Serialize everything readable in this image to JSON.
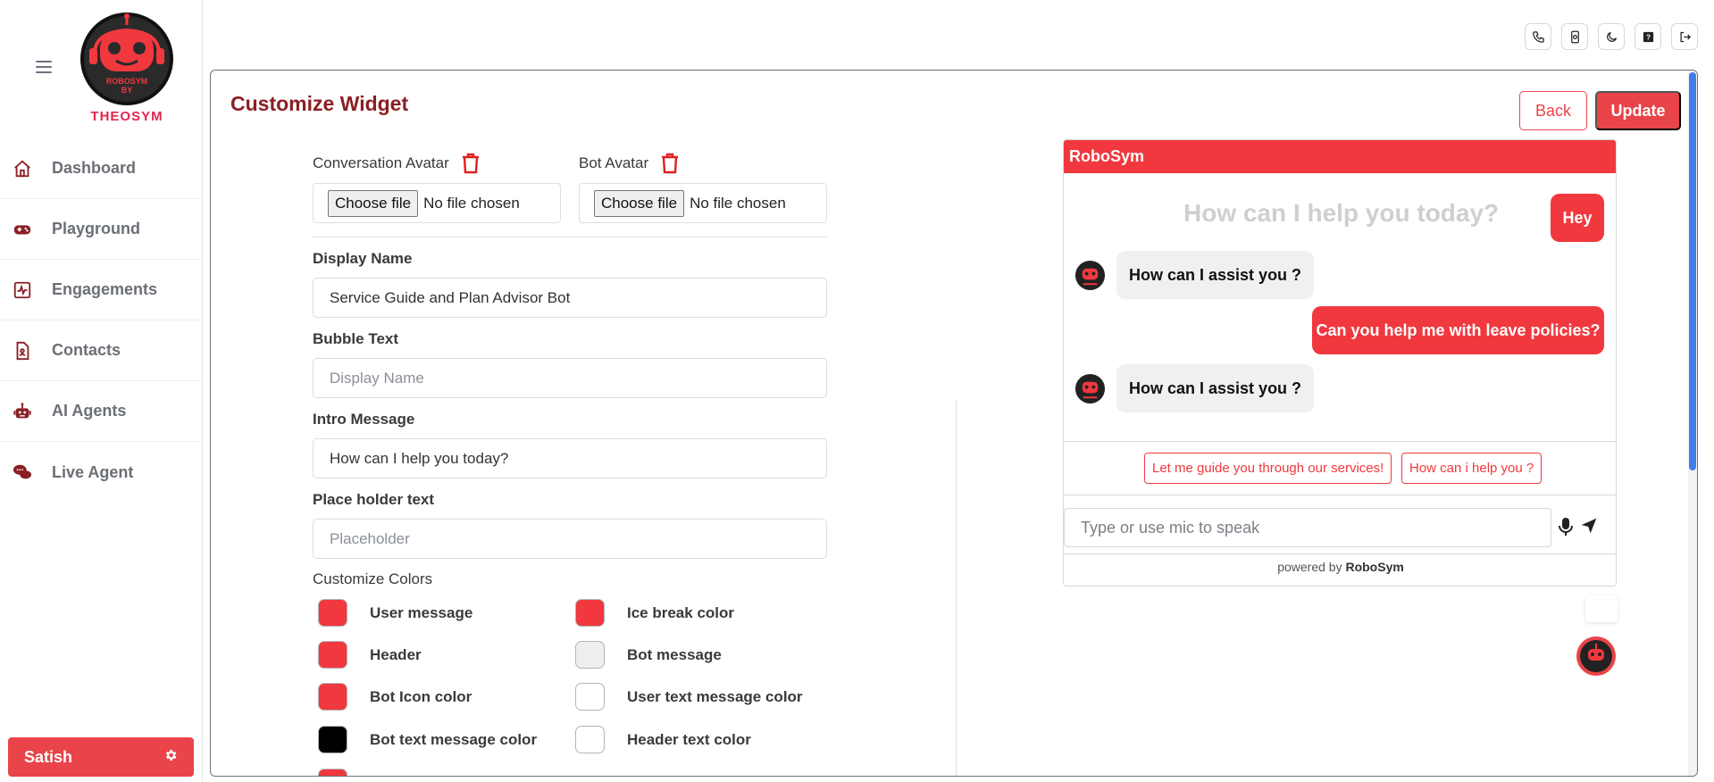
{
  "brand": {
    "logo_line1": "ROBOSYM",
    "logo_line2": "BY",
    "logo_line3": "THEOSYM",
    "accent": "#e84449"
  },
  "sidebar": {
    "items": [
      {
        "label": "Dashboard",
        "icon": "home-icon"
      },
      {
        "label": "Playground",
        "icon": "gamepad-icon"
      },
      {
        "label": "Engagements",
        "icon": "activity-icon"
      },
      {
        "label": "Contacts",
        "icon": "contact-file-icon"
      },
      {
        "label": "AI Agents",
        "icon": "robot-icon"
      },
      {
        "label": "Live Agent",
        "icon": "chat-bubbles-icon"
      }
    ],
    "user_name": "Satish"
  },
  "topbar": {
    "icons": [
      "phone-icon",
      "phone-settings-icon",
      "moon-icon",
      "help-icon",
      "logout-icon"
    ]
  },
  "page": {
    "title": "Customize Widget",
    "back_label": "Back",
    "update_label": "Update"
  },
  "form": {
    "conversation_avatar_label": "Conversation Avatar",
    "bot_avatar_label": "Bot Avatar",
    "file_button": "Choose file",
    "file_status": "No file chosen",
    "display_name_label": "Display Name",
    "display_name_value": "Service Guide and Plan Advisor Bot",
    "bubble_text_label": "Bubble Text",
    "bubble_text_placeholder": "Display Name",
    "intro_message_label": "Intro Message",
    "intro_message_value": "How can I help you today?",
    "placeholder_text_label": "Place holder text",
    "placeholder_text_placeholder": "Placeholder",
    "customize_colors_label": "Customize Colors",
    "colors": [
      {
        "label": "User message",
        "color": "#f1383e"
      },
      {
        "label": "Ice break color",
        "color": "#f1383e"
      },
      {
        "label": "Header",
        "color": "#f1383e"
      },
      {
        "label": "Bot message",
        "color": "#eeeeee"
      },
      {
        "label": "Bot Icon color",
        "color": "#f1383e"
      },
      {
        "label": "User text message color",
        "color": "#ffffff"
      },
      {
        "label": "Bot text message color",
        "color": "#000000"
      },
      {
        "label": "Header text color",
        "color": "#ffffff"
      }
    ]
  },
  "preview": {
    "header": "RoboSym",
    "intro": "How can I help you today?",
    "user_msg_1": "Hey",
    "bot_msg_1": "How can I assist you ?",
    "user_msg_2": "Can you help me with leave policies?",
    "bot_msg_2": "How can I assist you ?",
    "chip_1": "Let me guide you through our services!",
    "chip_2": "How can i help you ?",
    "input_placeholder": "Type or use mic to speak",
    "powered_prefix": "powered by",
    "powered_brand": "RoboSym"
  }
}
